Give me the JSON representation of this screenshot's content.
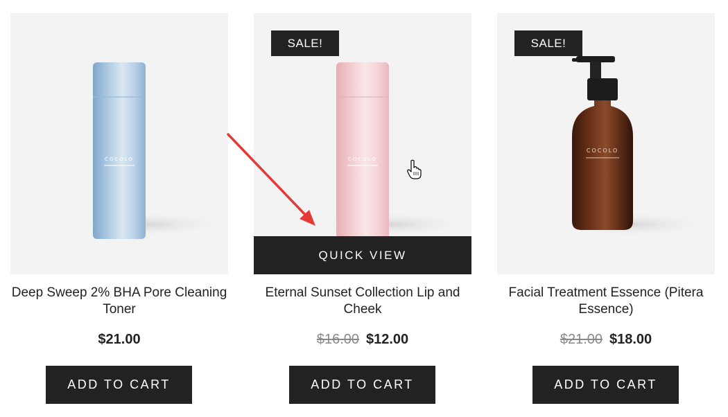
{
  "products": [
    {
      "title": "Deep Sweep 2% BHA Pore Cleaning Toner",
      "price": "$21.00",
      "add_to_cart_label": "ADD TO CART",
      "bottle_brand": "COCOLO",
      "bottle_color": "#a9c6e0"
    },
    {
      "title": "Eternal Sunset Collection Lip and Cheek",
      "badge": "SALE!",
      "old_price": "$16.00",
      "price": "$12.00",
      "quick_view_label": "QUICK VIEW",
      "add_to_cart_label": "ADD TO CART",
      "bottle_brand": "COCOLO",
      "bottle_color": "#f1c9cd"
    },
    {
      "title": "Facial Treatment Essence (Pitera Essence)",
      "badge": "SALE!",
      "old_price": "$21.00",
      "price": "$18.00",
      "add_to_cart_label": "ADD TO CART",
      "bottle_brand": "COCOLO",
      "bottle_color": "#5a2a14"
    }
  ],
  "annotation": {
    "arrow_icon": "red-arrow-icon",
    "arrow_color": "#e53935",
    "cursor_icon": "hand-pointer-icon"
  }
}
